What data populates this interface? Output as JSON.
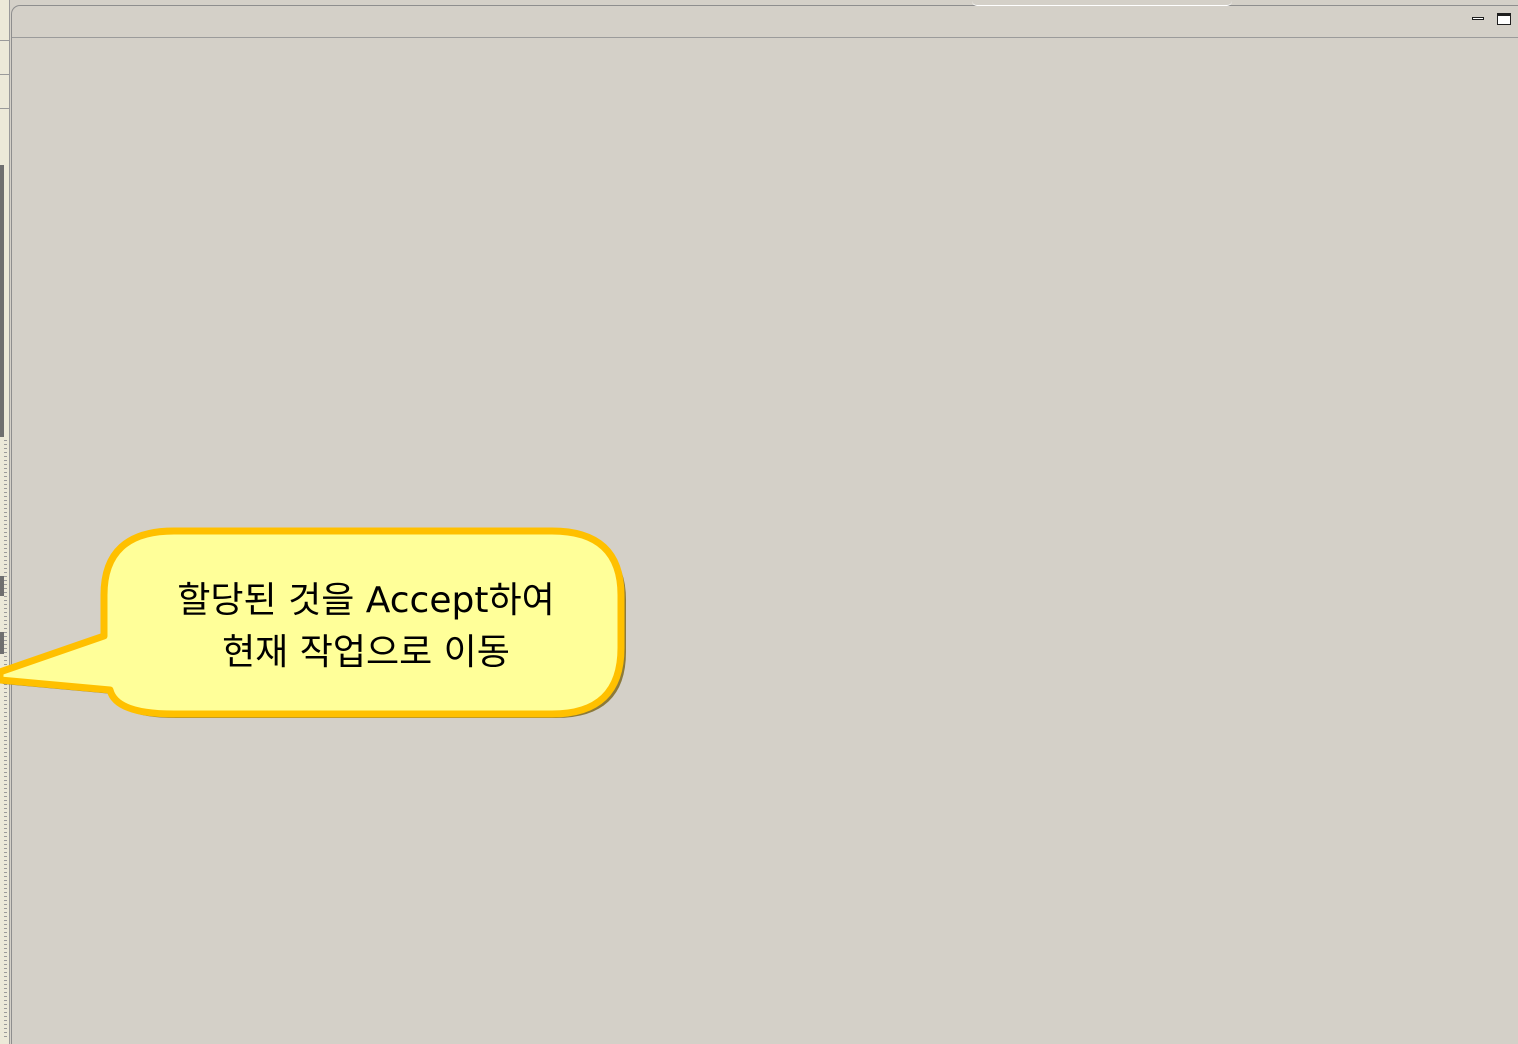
{
  "view": {
    "toolbar": {
      "minimize_icon": "minimize-icon",
      "maximize_icon": "maximize-icon"
    }
  },
  "callout": {
    "line1": "할당된 것을 Accept하여",
    "line2": "현재 작업으로 이동",
    "fill_color": "#ffff99",
    "border_color": "#ffc000",
    "shadow_color": "#8c7a3a"
  },
  "colors": {
    "background": "#d4d0c8",
    "border": "#8e8e8e"
  }
}
